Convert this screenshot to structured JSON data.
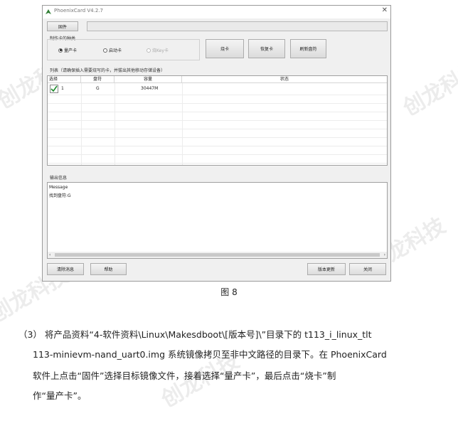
{
  "window": {
    "title": "PhoenixCard V4.2.7",
    "close_glyph": "✕",
    "firmware_button": "固件",
    "firmware_path": "",
    "card_type_group": "制作卡的种类",
    "radio_options": [
      {
        "label": "量产卡",
        "selected": true,
        "enabled": true
      },
      {
        "label": "启动卡",
        "selected": false,
        "enabled": true
      },
      {
        "label": "烧Key卡",
        "selected": false,
        "enabled": false
      }
    ],
    "burn_button": "烧卡",
    "restore_button": "恢复卡",
    "refresh_button": "刷新盘符"
  },
  "device_list": {
    "label": "列表（请确保插入需要烧写的卡，并拔出其他移动存储设备）",
    "columns": [
      "选择",
      "盘符",
      "容量",
      "状态"
    ],
    "rows": [
      {
        "checked": true,
        "index": "1",
        "drive": "G",
        "capacity": "30447M",
        "status": ""
      }
    ]
  },
  "output": {
    "label": "输出信息",
    "lines": [
      "Message",
      "找到盘符:G"
    ]
  },
  "bottom_buttons": {
    "clear": "清除消息",
    "help": "帮助",
    "update": "版本更新",
    "close": "关闭"
  },
  "figure_caption": "图  8",
  "paragraph": {
    "lines": [
      "（3）    将产品资料“4-软件资料\\Linux\\Makesdboot\\[版本号]\\”目录下的 t113_i_linux_tlt",
      "113-minievm-nand_uart0.img 系统镜像拷贝至非中文路径的目录下。在 PhoenixCard",
      "软件上点击“固件”选择目标镜像文件，接着选择“量产卡”，最后点击“烧卡”制",
      "作“量产卡”。"
    ]
  },
  "watermark": "创龙科技",
  "colors": {
    "check": "#1a8a2a",
    "window_bg": "#f0f0f0"
  }
}
